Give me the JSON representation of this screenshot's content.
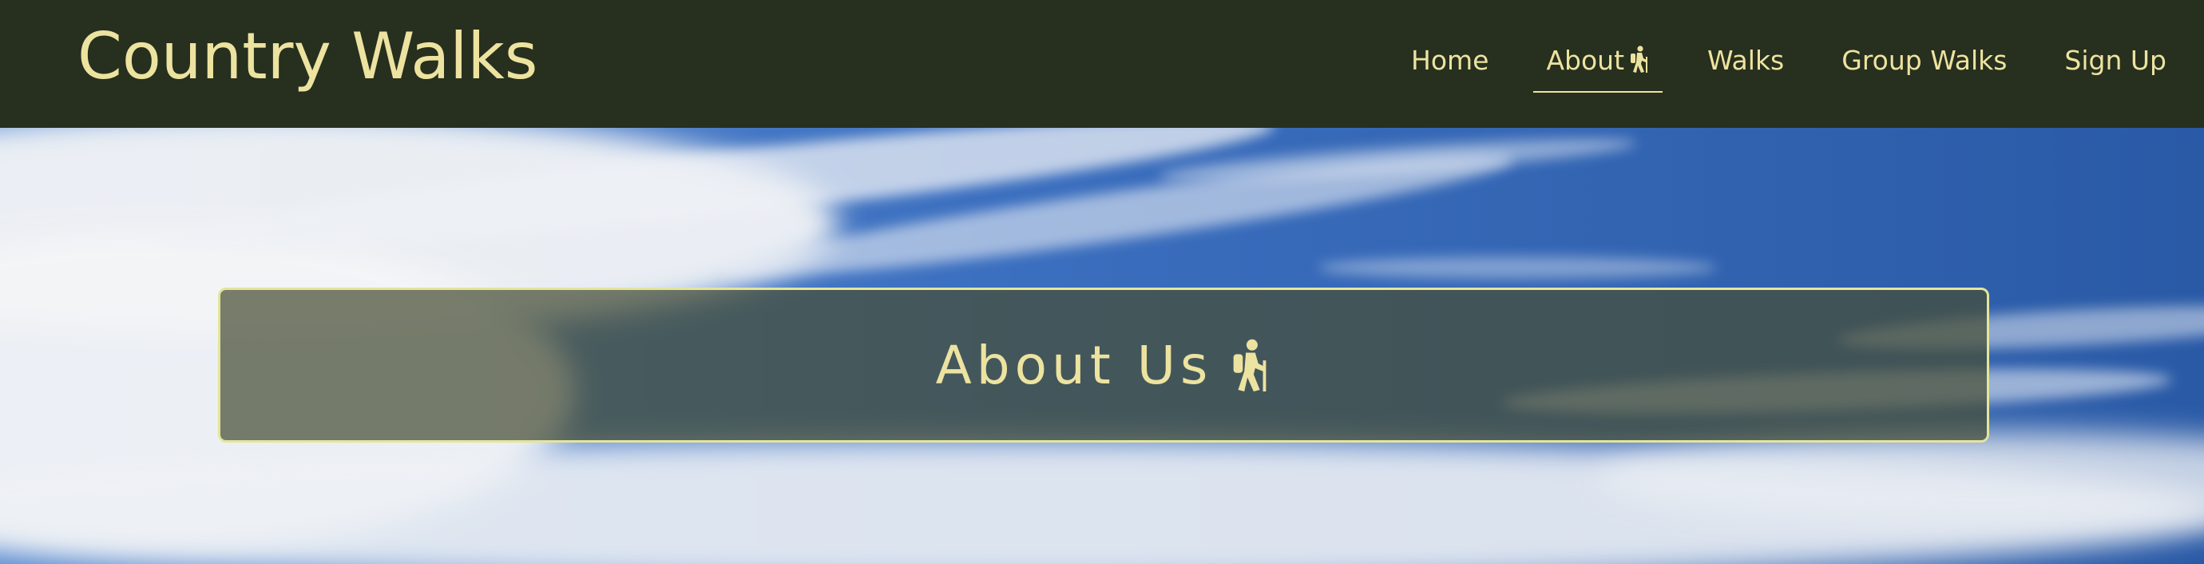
{
  "header": {
    "brand": "Country Walks"
  },
  "nav": {
    "items": [
      {
        "label": "Home",
        "active": false
      },
      {
        "label": "About",
        "active": true,
        "icon": "person-hiking-icon"
      },
      {
        "label": "Walks",
        "active": false
      },
      {
        "label": "Group Walks",
        "active": false
      },
      {
        "label": "Sign Up",
        "active": false
      }
    ]
  },
  "hero": {
    "title": "About Us",
    "icon": "person-hiking-icon",
    "background": "blue sky with wispy clouds"
  },
  "colors": {
    "navbar_bg": "#272f1e",
    "accent_text": "#ede3a0",
    "box_border": "#e3e59a",
    "sky": "#2f62b0"
  }
}
